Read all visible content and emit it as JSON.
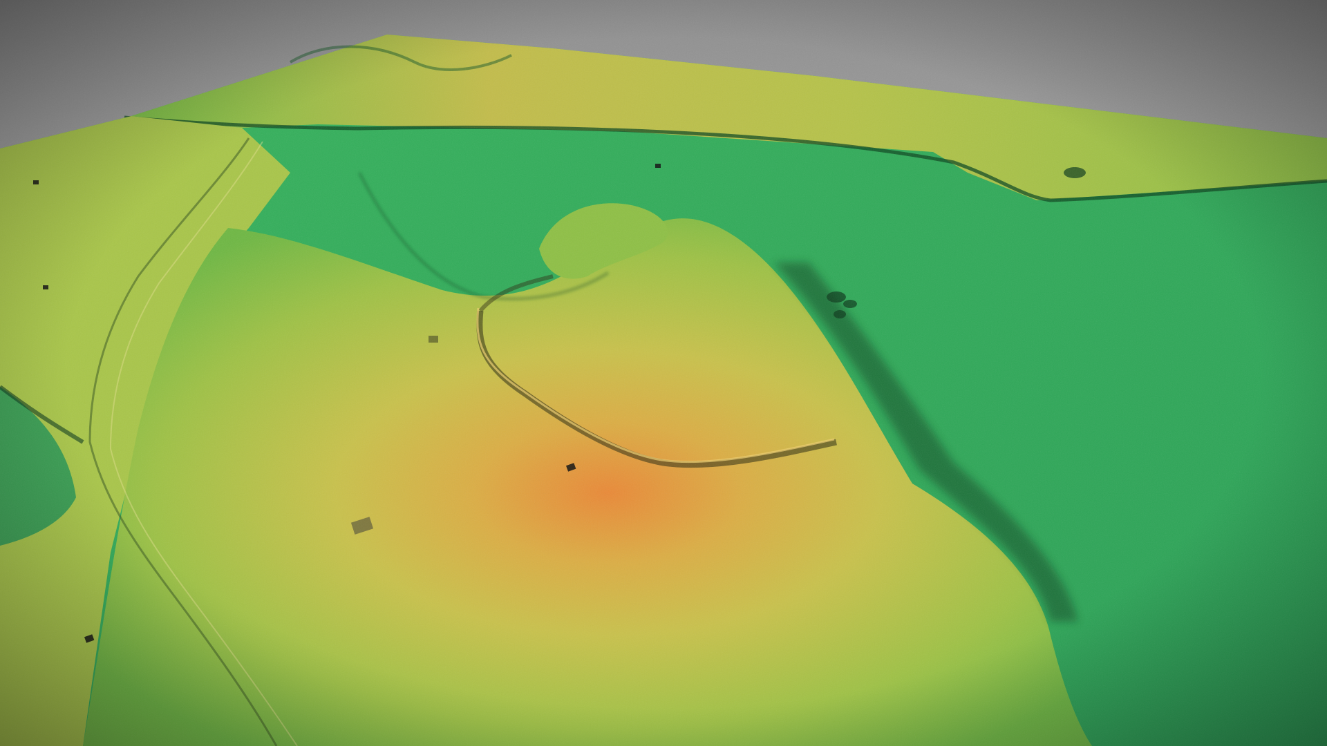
{
  "view": {
    "kind": "3D terrain elevation render (hillshaded LiDAR-style)",
    "colors": {
      "sky_top": "#8f8f8f",
      "sky_bottom": "#d6d6d6",
      "lowland_green": "#2fae5a",
      "mid_green": "#5fbf45",
      "yellow_green": "#b8c84a",
      "yellow": "#d9c24e",
      "orange_peak": "#e8893a",
      "shadow": "#0d3a1c"
    },
    "elevation_legend_visible": false
  }
}
